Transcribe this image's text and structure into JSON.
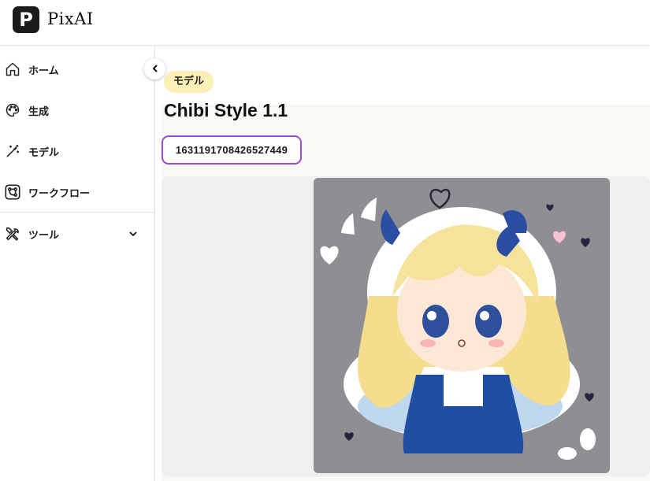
{
  "header": {
    "logo_letter": "P",
    "app_name": "PixAI"
  },
  "sidebar": {
    "items": [
      {
        "label": "ホーム",
        "icon": "home-icon"
      },
      {
        "label": "生成",
        "icon": "palette-icon"
      },
      {
        "label": "モデル",
        "icon": "magic-wand-icon"
      },
      {
        "label": "ワークフロー",
        "icon": "workflow-icon"
      },
      {
        "label": "ツール",
        "icon": "tools-icon"
      }
    ]
  },
  "main": {
    "tag": "モデル",
    "title": "Chibi Style 1.1",
    "model_id": "1631191708426527449",
    "preview_image": "chibi-girl-illustration"
  },
  "colors": {
    "tag_bg": "#fbf0b5",
    "id_border": "#9b4bd6",
    "content_bg": "#f9f8f4",
    "image_bg": "#8f8e93"
  }
}
